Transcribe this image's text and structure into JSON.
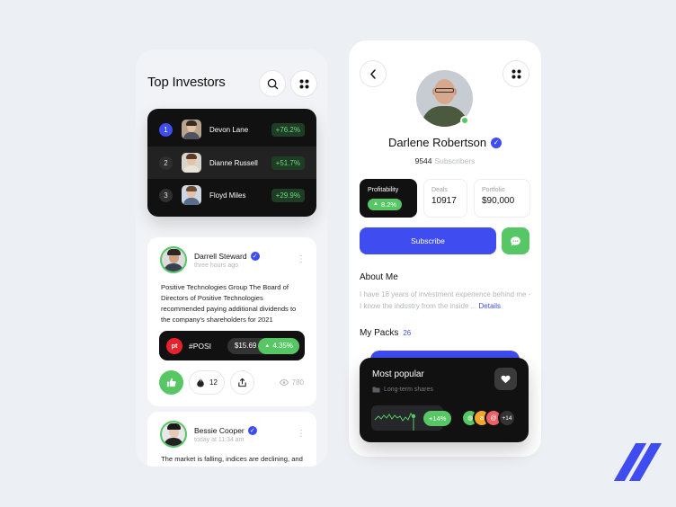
{
  "top_investors": {
    "title": "Top Investors",
    "ranking": [
      {
        "rank": "1",
        "name": "Devon Lane",
        "change": "+76.2%"
      },
      {
        "rank": "2",
        "name": "Dianne Russell",
        "change": "+51.7%"
      },
      {
        "rank": "3",
        "name": "Floyd Miles",
        "change": "+29.9%"
      }
    ],
    "posts": [
      {
        "author": "Darrell Steward",
        "time": "three hours ago",
        "text": "Positive Technologies Group The Board of Directors of Positive Technologies recommended paying additional dividends to the company's shareholders for 2021",
        "ticker": {
          "logo": "pt",
          "symbol": "#POSI",
          "price": "$15.69",
          "change": "4.35%"
        },
        "comments": "12",
        "views": "780"
      },
      {
        "author": "Bessie Cooper",
        "time": "today at 11:34 am",
        "text": "The market is falling, indices are declining, and"
      }
    ]
  },
  "profile": {
    "name": "Darlene Robertson",
    "subscribers_count": "9544",
    "subscribers_label": "Subscribers",
    "stats": {
      "profitability_label": "Profitability",
      "profitability_value": "8.2%",
      "deals_label": "Deals",
      "deals_value": "10917",
      "portfolio_label": "Portfolio",
      "portfolio_value": "$90,000"
    },
    "subscribe_label": "Subscribe",
    "about_title": "About Me",
    "about_text": "I have 18 years of investment experience behind me - I know the industry from the inside ...",
    "details_label": "Details",
    "packs_title": "My Packs",
    "packs_count": "26",
    "pack": {
      "title": "Most popular",
      "subtitle": "Long-term shares",
      "change": "+14%",
      "more_count": "+14"
    }
  },
  "colors": {
    "accent": "#3e4cf0",
    "positive": "#57c766",
    "dark": "#111111"
  }
}
